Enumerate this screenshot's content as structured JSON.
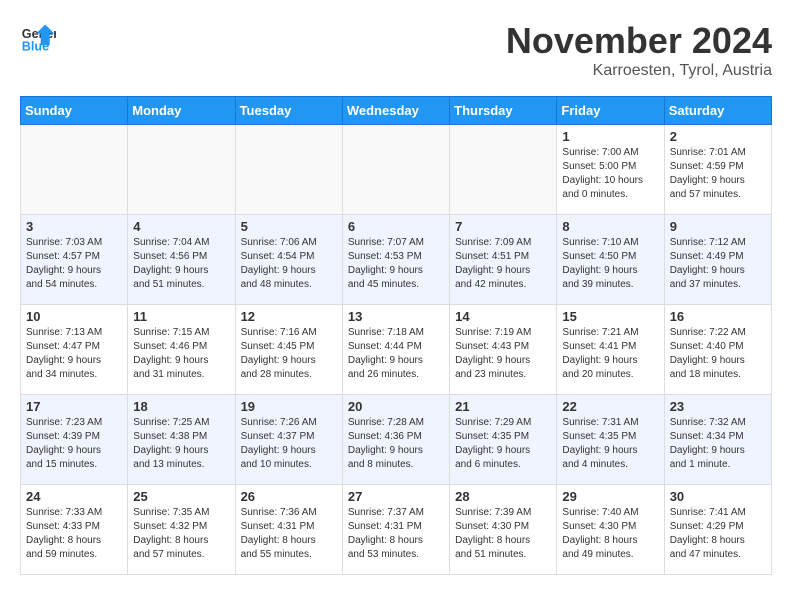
{
  "header": {
    "logo_line1": "General",
    "logo_line2": "Blue",
    "month_title": "November 2024",
    "subtitle": "Karroesten, Tyrol, Austria"
  },
  "weekdays": [
    "Sunday",
    "Monday",
    "Tuesday",
    "Wednesday",
    "Thursday",
    "Friday",
    "Saturday"
  ],
  "weeks": [
    [
      {
        "day": "",
        "info": ""
      },
      {
        "day": "",
        "info": ""
      },
      {
        "day": "",
        "info": ""
      },
      {
        "day": "",
        "info": ""
      },
      {
        "day": "",
        "info": ""
      },
      {
        "day": "1",
        "info": "Sunrise: 7:00 AM\nSunset: 5:00 PM\nDaylight: 10 hours\nand 0 minutes."
      },
      {
        "day": "2",
        "info": "Sunrise: 7:01 AM\nSunset: 4:59 PM\nDaylight: 9 hours\nand 57 minutes."
      }
    ],
    [
      {
        "day": "3",
        "info": "Sunrise: 7:03 AM\nSunset: 4:57 PM\nDaylight: 9 hours\nand 54 minutes."
      },
      {
        "day": "4",
        "info": "Sunrise: 7:04 AM\nSunset: 4:56 PM\nDaylight: 9 hours\nand 51 minutes."
      },
      {
        "day": "5",
        "info": "Sunrise: 7:06 AM\nSunset: 4:54 PM\nDaylight: 9 hours\nand 48 minutes."
      },
      {
        "day": "6",
        "info": "Sunrise: 7:07 AM\nSunset: 4:53 PM\nDaylight: 9 hours\nand 45 minutes."
      },
      {
        "day": "7",
        "info": "Sunrise: 7:09 AM\nSunset: 4:51 PM\nDaylight: 9 hours\nand 42 minutes."
      },
      {
        "day": "8",
        "info": "Sunrise: 7:10 AM\nSunset: 4:50 PM\nDaylight: 9 hours\nand 39 minutes."
      },
      {
        "day": "9",
        "info": "Sunrise: 7:12 AM\nSunset: 4:49 PM\nDaylight: 9 hours\nand 37 minutes."
      }
    ],
    [
      {
        "day": "10",
        "info": "Sunrise: 7:13 AM\nSunset: 4:47 PM\nDaylight: 9 hours\nand 34 minutes."
      },
      {
        "day": "11",
        "info": "Sunrise: 7:15 AM\nSunset: 4:46 PM\nDaylight: 9 hours\nand 31 minutes."
      },
      {
        "day": "12",
        "info": "Sunrise: 7:16 AM\nSunset: 4:45 PM\nDaylight: 9 hours\nand 28 minutes."
      },
      {
        "day": "13",
        "info": "Sunrise: 7:18 AM\nSunset: 4:44 PM\nDaylight: 9 hours\nand 26 minutes."
      },
      {
        "day": "14",
        "info": "Sunrise: 7:19 AM\nSunset: 4:43 PM\nDaylight: 9 hours\nand 23 minutes."
      },
      {
        "day": "15",
        "info": "Sunrise: 7:21 AM\nSunset: 4:41 PM\nDaylight: 9 hours\nand 20 minutes."
      },
      {
        "day": "16",
        "info": "Sunrise: 7:22 AM\nSunset: 4:40 PM\nDaylight: 9 hours\nand 18 minutes."
      }
    ],
    [
      {
        "day": "17",
        "info": "Sunrise: 7:23 AM\nSunset: 4:39 PM\nDaylight: 9 hours\nand 15 minutes."
      },
      {
        "day": "18",
        "info": "Sunrise: 7:25 AM\nSunset: 4:38 PM\nDaylight: 9 hours\nand 13 minutes."
      },
      {
        "day": "19",
        "info": "Sunrise: 7:26 AM\nSunset: 4:37 PM\nDaylight: 9 hours\nand 10 minutes."
      },
      {
        "day": "20",
        "info": "Sunrise: 7:28 AM\nSunset: 4:36 PM\nDaylight: 9 hours\nand 8 minutes."
      },
      {
        "day": "21",
        "info": "Sunrise: 7:29 AM\nSunset: 4:35 PM\nDaylight: 9 hours\nand 6 minutes."
      },
      {
        "day": "22",
        "info": "Sunrise: 7:31 AM\nSunset: 4:35 PM\nDaylight: 9 hours\nand 4 minutes."
      },
      {
        "day": "23",
        "info": "Sunrise: 7:32 AM\nSunset: 4:34 PM\nDaylight: 9 hours\nand 1 minute."
      }
    ],
    [
      {
        "day": "24",
        "info": "Sunrise: 7:33 AM\nSunset: 4:33 PM\nDaylight: 8 hours\nand 59 minutes."
      },
      {
        "day": "25",
        "info": "Sunrise: 7:35 AM\nSunset: 4:32 PM\nDaylight: 8 hours\nand 57 minutes."
      },
      {
        "day": "26",
        "info": "Sunrise: 7:36 AM\nSunset: 4:31 PM\nDaylight: 8 hours\nand 55 minutes."
      },
      {
        "day": "27",
        "info": "Sunrise: 7:37 AM\nSunset: 4:31 PM\nDaylight: 8 hours\nand 53 minutes."
      },
      {
        "day": "28",
        "info": "Sunrise: 7:39 AM\nSunset: 4:30 PM\nDaylight: 8 hours\nand 51 minutes."
      },
      {
        "day": "29",
        "info": "Sunrise: 7:40 AM\nSunset: 4:30 PM\nDaylight: 8 hours\nand 49 minutes."
      },
      {
        "day": "30",
        "info": "Sunrise: 7:41 AM\nSunset: 4:29 PM\nDaylight: 8 hours\nand 47 minutes."
      }
    ]
  ]
}
